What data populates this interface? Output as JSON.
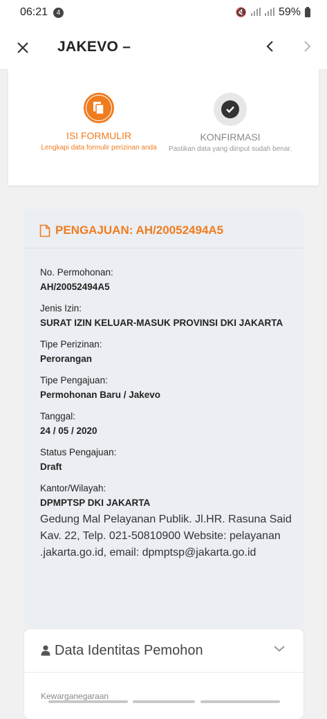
{
  "status": {
    "time": "06:21",
    "badge": "4",
    "battery": "59%"
  },
  "appbar": {
    "title": "JAKEVO –"
  },
  "stepper": {
    "steps": [
      {
        "label": "ISI FORMULIR",
        "desc": "Lengkapi data formulir perizinan anda"
      },
      {
        "label": "KONFIRMASI",
        "desc": "Pastikan data yang diinput sudah benar."
      }
    ]
  },
  "detail": {
    "title": "PENGAJUAN: AH/20052494A5",
    "fields": [
      {
        "label": "No. Permohonan:",
        "value": "AH/20052494A5"
      },
      {
        "label": "Jenis Izin:",
        "value": "SURAT IZIN KELUAR-MASUK PROVINSI DKI JAKARTA"
      },
      {
        "label": "Tipe Perizinan:",
        "value": "Perorangan"
      },
      {
        "label": "Tipe Pengajuan:",
        "value": "Permohonan Baru / Jakevo"
      },
      {
        "label": "Tanggal:",
        "value": "24 / 05 / 2020"
      },
      {
        "label": "Status Pengajuan:",
        "value": "Draft"
      },
      {
        "label": "Kantor/Wilayah:",
        "value": "DPMPTSP DKI JAKARTA"
      }
    ],
    "address": "Gedung Mal Pelayanan Publik. Jl.HR. Rasuna Said Kav. 22, Telp. 021-50810900 Website: pelayanan .jakarta.go.id, email: dpmptsp@jakarta.go.id"
  },
  "identity": {
    "title": "Data Identitas Pemohon",
    "first_field_label": "Kewarganegaraan"
  },
  "colors": {
    "accent": "#f07c1e",
    "detail_bg": "#ebeef2"
  },
  "icons": [
    "close-icon",
    "chevron-left-icon",
    "chevron-right-icon",
    "document-icon",
    "check-icon",
    "file-icon",
    "user-icon",
    "chevron-down-icon"
  ]
}
